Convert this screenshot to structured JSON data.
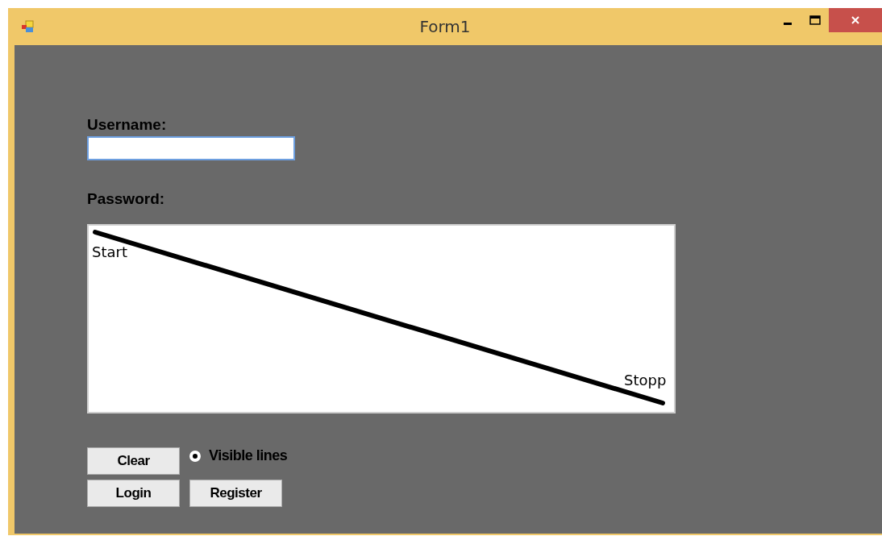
{
  "window": {
    "title": "Form1"
  },
  "form": {
    "username_label": "Username:",
    "password_label": "Password:"
  },
  "drawing": {
    "start_label": "Start",
    "end_label": "Stopp"
  },
  "buttons": {
    "clear": "Clear",
    "login": "Login",
    "register": "Register"
  },
  "radio": {
    "label": "Visible lines",
    "selected": true
  }
}
